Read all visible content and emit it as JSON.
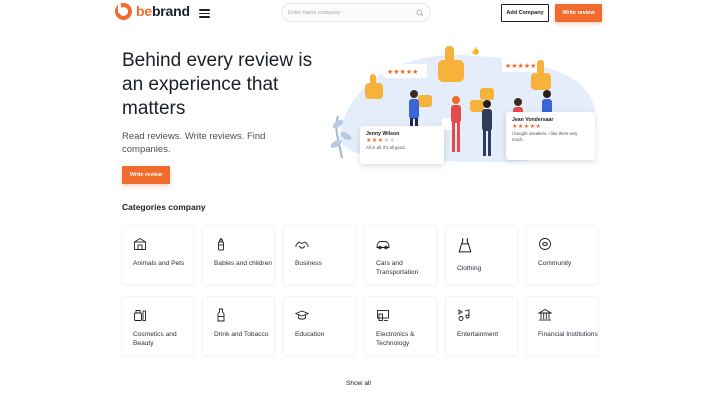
{
  "header": {
    "logo_prefix": "be",
    "logo_suffix": "brand",
    "search_placeholder": "Enter name company",
    "add_company": "Add Company",
    "write_review": "Write review"
  },
  "hero": {
    "title": "Behind every review is an experience that matters",
    "subtitle": "Read reviews. Write reviews. Find companies.",
    "cta": "Write review"
  },
  "reviews": [
    {
      "name": "Jenny Wilson",
      "rating": 3,
      "text": "All in all, it's all good."
    },
    {
      "name": "Jean Vondersaar",
      "rating": 5,
      "text": "I bought sneakers. I like them very much."
    }
  ],
  "categories": {
    "title": "Categories company",
    "items": [
      {
        "label": "Animals and Pets",
        "icon": "animals-pets-icon"
      },
      {
        "label": "Babies and children",
        "icon": "baby-bottle-icon"
      },
      {
        "label": "Business",
        "icon": "business-handshake-icon"
      },
      {
        "label": "Cars and Transportation",
        "icon": "car-icon"
      },
      {
        "label": "Clothing",
        "icon": "dress-icon"
      },
      {
        "label": "Community",
        "icon": "community-icon"
      },
      {
        "label": "Cosmetics and Beauty",
        "icon": "cosmetics-icon"
      },
      {
        "label": "Drink and Tobacco",
        "icon": "bottle-icon"
      },
      {
        "label": "Education",
        "icon": "graduation-cap-icon"
      },
      {
        "label": "Electronics & Technology",
        "icon": "electronics-icon"
      },
      {
        "label": "Entertainment",
        "icon": "entertainment-icon"
      },
      {
        "label": "Financial Institutions",
        "icon": "bank-icon"
      }
    ],
    "show_all": "Show all"
  },
  "colors": {
    "accent": "#f26b2e",
    "text": "#1b1f2a",
    "illustration_blue": "#dbe6f6"
  }
}
